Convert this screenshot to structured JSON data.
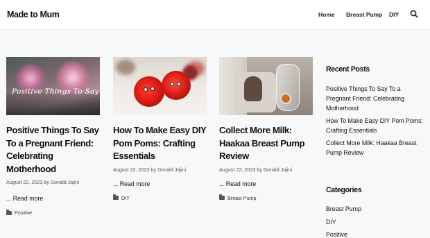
{
  "header": {
    "site_title": "Made to Mum",
    "nav": [
      "Home",
      "Breast Pump",
      "DIY"
    ],
    "search_icon": "search-icon"
  },
  "posts": [
    {
      "image_overlay_text": "Positive Things To Say",
      "title": "Positive Things To Say To a Pregnant Friend: Celebrating Motherhood",
      "date": "August 22, 2023",
      "author": "Donald Jajini",
      "read_more": "... Read more",
      "category": "Positive"
    },
    {
      "title": "How To Make Easy DIY Pom Poms: Crafting Essentials",
      "date": "August 22, 2023",
      "author": "Donald Jajini",
      "read_more": "... Read more",
      "category": "DIY"
    },
    {
      "title": "Collect More Milk: Haakaa Breast Pump Review",
      "date": "August 22, 2023",
      "author": "Donald Jajini",
      "read_more": "... Read more",
      "category": "Breast Pump"
    }
  ],
  "meta_by": "by",
  "category_icon": "folder-icon",
  "sidebar": {
    "recent_title": "Recent Posts",
    "recent_posts": [
      "Positive Things To Say To a Pregnant Friend: Celebrating Motherhood",
      "How To Make Easy DIY Pom Poms: Crafting Essentials",
      "Collect More Milk: Haakaa Breast Pump Review"
    ],
    "categories_title": "Categories",
    "categories": [
      "Breast Pump",
      "DIY",
      "Positive"
    ]
  }
}
